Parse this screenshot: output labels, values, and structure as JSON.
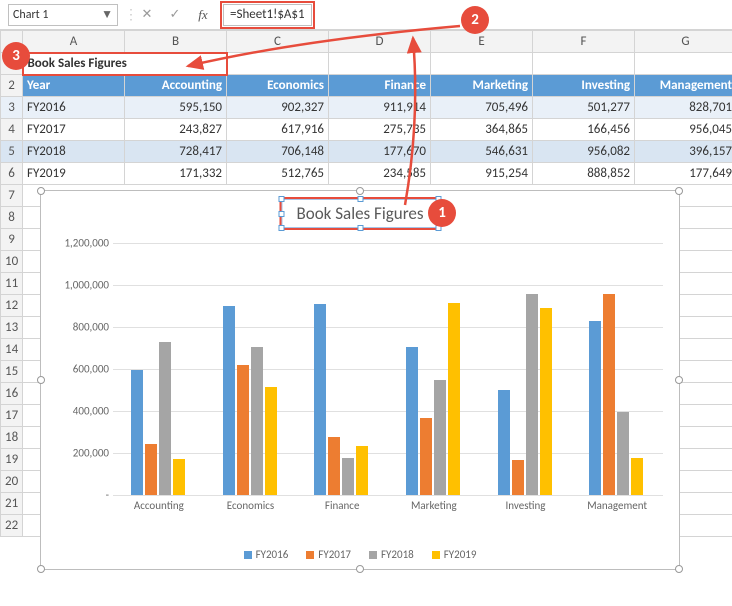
{
  "toolbar": {
    "namebox": "Chart 1",
    "formula": "=Sheet1!$A$1"
  },
  "callouts": {
    "c1": "1",
    "c2": "2",
    "c3": "3"
  },
  "columns": [
    "",
    "A",
    "B",
    "C",
    "D",
    "E",
    "F",
    "G"
  ],
  "row_labels": [
    "1",
    "2",
    "3",
    "4",
    "5",
    "6",
    "7",
    "8",
    "9",
    "10",
    "11",
    "12",
    "13",
    "14",
    "15",
    "16",
    "17",
    "18",
    "19",
    "20",
    "21",
    "22"
  ],
  "a1": "Book Sales Figures",
  "headers": [
    "Year",
    "Accounting",
    "Economics",
    "Finance",
    "Marketing",
    "Investing",
    "Management"
  ],
  "rows": [
    [
      "FY2016",
      "595,150",
      "902,327",
      "911,914",
      "705,496",
      "501,277",
      "828,701"
    ],
    [
      "FY2017",
      "243,827",
      "617,916",
      "275,735",
      "364,865",
      "166,456",
      "956,045"
    ],
    [
      "FY2018",
      "728,417",
      "706,148",
      "177,670",
      "546,631",
      "956,082",
      "396,157"
    ],
    [
      "FY2019",
      "171,332",
      "512,765",
      "234,585",
      "915,254",
      "888,852",
      "177,649"
    ]
  ],
  "chart_title": "Book Sales Figures",
  "chart_data": {
    "type": "bar",
    "title": "Book Sales Figures",
    "xlabel": "",
    "ylabel": "",
    "ylim": [
      0,
      1200000
    ],
    "yticks": [
      "-",
      "200,000",
      "400,000",
      "600,000",
      "800,000",
      "1,000,000",
      "1,200,000"
    ],
    "categories": [
      "Accounting",
      "Economics",
      "Finance",
      "Marketing",
      "Investing",
      "Management"
    ],
    "series": [
      {
        "name": "FY2016",
        "color": "#5b9bd5",
        "values": [
          595150,
          902327,
          911914,
          705496,
          501277,
          828701
        ]
      },
      {
        "name": "FY2017",
        "color": "#ed7d31",
        "values": [
          243827,
          617916,
          275735,
          364865,
          166456,
          956045
        ]
      },
      {
        "name": "FY2018",
        "color": "#a5a5a5",
        "values": [
          728417,
          706148,
          177670,
          546631,
          956082,
          396157
        ]
      },
      {
        "name": "FY2019",
        "color": "#ffc000",
        "values": [
          171332,
          512765,
          234585,
          915254,
          888852,
          177649
        ]
      }
    ]
  }
}
